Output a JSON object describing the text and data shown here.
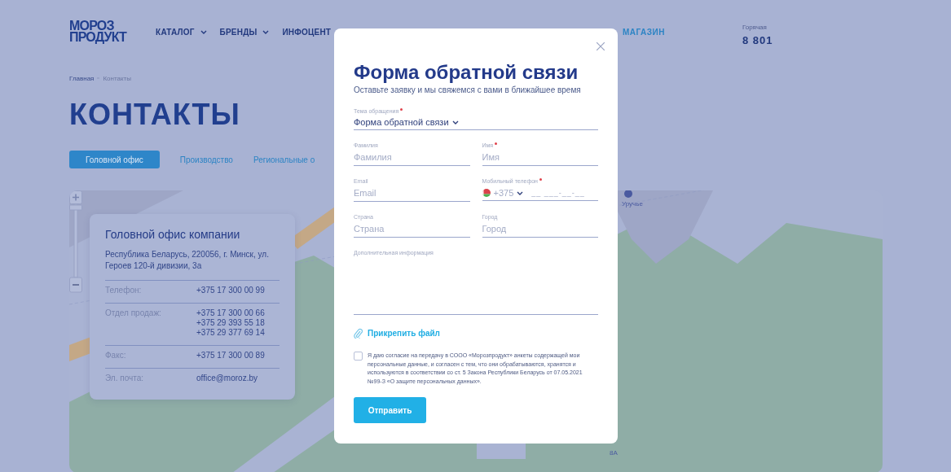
{
  "header": {
    "logo": [
      "МОРОЗ",
      "ПРОДУКТ"
    ],
    "nav": [
      {
        "label": "КАТАЛОГ",
        "dropdown": true
      },
      {
        "label": "БРЕНДЫ",
        "dropdown": true
      },
      {
        "label": "ИНФОЦЕНТ",
        "dropdown": false
      }
    ],
    "shop_link": "МАГАЗИН",
    "hotline_label": "Горячая",
    "hotline_number": "8 801"
  },
  "breadcrumbs": [
    "Главная",
    "Контакты"
  ],
  "page_title": "КОНТАКТЫ",
  "tabs": [
    {
      "label": "Головной офис",
      "selected": true
    },
    {
      "label": "Производство",
      "selected": false
    },
    {
      "label": "Региональные о",
      "selected": false
    }
  ],
  "map": {
    "labels": [
      "Уручье",
      "8А"
    ]
  },
  "office_card": {
    "title": "Головной офис компании",
    "address": "Республика Беларусь, 220056, г. Минск, ул. Героев 120-й дивизии, 3а",
    "rows": [
      {
        "label": "Телефон:",
        "values": [
          "+375 17 300 00 99"
        ]
      },
      {
        "label": "Отдел продаж:",
        "values": [
          "+375 17 300 00 66",
          "+375 29 393 55 18",
          "+375 29 377 69 14"
        ]
      },
      {
        "label": "Факс:",
        "values": [
          "+375 17 300 00 89"
        ]
      },
      {
        "label": "Эл. почта:",
        "values": [
          "office@moroz.by"
        ]
      }
    ]
  },
  "modal": {
    "title": "Форма обратной связи",
    "subtitle": "Оставьте заявку и мы свяжемся с вами в ближайшее время",
    "topic": {
      "label": "Тема обращения",
      "required": true,
      "value": "Форма обратной связи"
    },
    "fields": [
      {
        "kind": "text",
        "label": "Фамилия",
        "required": false,
        "placeholder": "Фамилия"
      },
      {
        "kind": "text",
        "label": "Имя",
        "required": true,
        "placeholder": "Имя"
      },
      {
        "kind": "text",
        "label": "Email",
        "required": false,
        "placeholder": "Email"
      },
      {
        "kind": "phone",
        "label": "Мобильный телефон",
        "required": true,
        "code": "+375",
        "placeholder": "__ ___-__-__"
      },
      {
        "kind": "text",
        "label": "Страна",
        "required": false,
        "placeholder": "Страна"
      },
      {
        "kind": "text",
        "label": "Город",
        "required": false,
        "placeholder": "Город"
      },
      {
        "kind": "textarea",
        "label": "Дополнительная информация",
        "required": false
      }
    ],
    "attach": "Прикрепить файл",
    "consent": {
      "checked": false,
      "text": "Я даю согласие на передачу в СООО «Морозпродукт» анкеты содержащей мои персональные данные, и согласен с тем, что они обрабатываются, хранятся и используются в соответствии со ст. 5 Закона Республики Беларусь от 07.05.2021 №99-З «О защите персональных данных»."
    },
    "submit": "Отправить"
  }
}
